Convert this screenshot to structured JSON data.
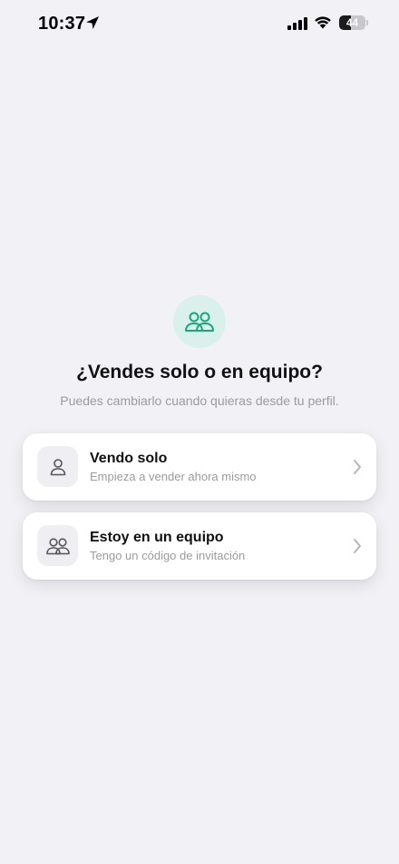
{
  "status_bar": {
    "time": "10:37",
    "battery_text": "44",
    "battery_level": 0.44
  },
  "hero": {
    "icon": "users-icon",
    "title": "¿Vendes solo o en equipo?",
    "subtitle": "Puedes cambiarlo cuando quieras desde tu perfil."
  },
  "options": [
    {
      "icon": "user-icon",
      "title": "Vendo solo",
      "subtitle": "Empieza a vender ahora mismo"
    },
    {
      "icon": "users-icon",
      "title": "Estoy en un equipo",
      "subtitle": "Tengo un código de invitación"
    }
  ],
  "colors": {
    "background": "#f1f1f6",
    "accent": "#1aa580",
    "accent_bg": "#d9f1ea",
    "muted_text": "#9a9aa0"
  }
}
